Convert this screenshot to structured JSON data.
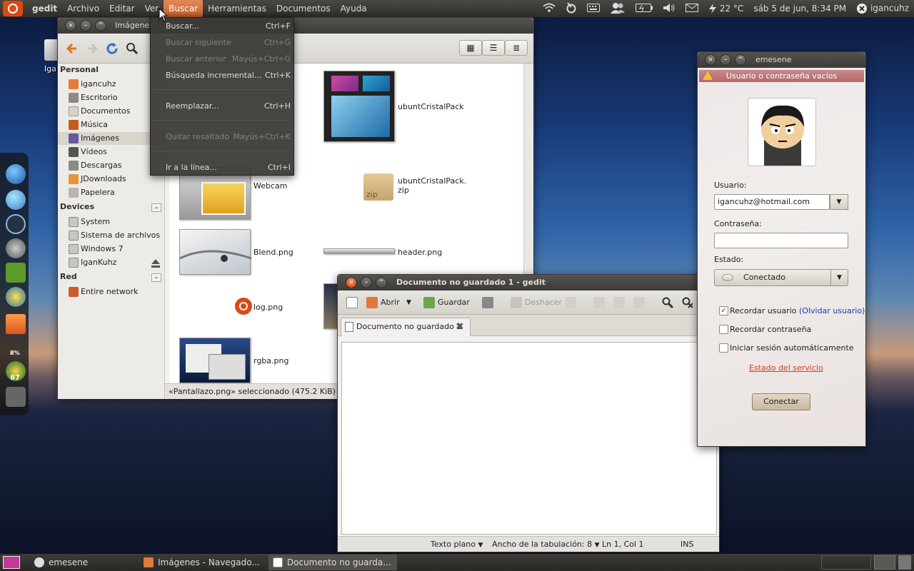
{
  "top_panel": {
    "app_name": "gedit",
    "menus": [
      "Archivo",
      "Editar",
      "Ver",
      "Buscar",
      "Herramientas",
      "Documentos",
      "Ayuda"
    ],
    "active_menu": "Buscar",
    "temperature": "22 °C",
    "clock": "sáb 5 de jun, 8:34 PM",
    "user": "igancuhz"
  },
  "search_menu": {
    "items": [
      {
        "label": "Buscar...",
        "accel": "Ctrl+F",
        "enabled": true
      },
      {
        "label": "Buscar siguiente",
        "accel": "Ctrl+G",
        "enabled": false
      },
      {
        "label": "Buscar anterior",
        "accel": "Mayús+Ctrl+G",
        "enabled": false
      },
      {
        "label": "Búsqueda incremental...",
        "accel": "Ctrl+K",
        "enabled": true
      },
      {
        "label": "Reemplazar...",
        "accel": "Ctrl+H",
        "enabled": true
      },
      {
        "label": "Quitar resaltado",
        "accel": "Mayús+Ctrl+K",
        "enabled": false
      },
      {
        "label": "Ir a la línea...",
        "accel": "Ctrl+I",
        "enabled": true
      }
    ]
  },
  "nautilus": {
    "title": "Imágenes",
    "sidebar": {
      "personal_heading": "Personal",
      "personal": [
        "igancuhz",
        "Escritorio",
        "Documentos",
        "Música",
        "Imágenes",
        "Vídeos",
        "Descargas",
        "JDownloads",
        "Papelera"
      ],
      "selected": "Imágenes",
      "devices_heading": "Devices",
      "devices": [
        "System",
        "Sistema de archivos ...",
        "Windows 7",
        "IganKuhz"
      ],
      "network_heading": "Red",
      "network": [
        "Entire network"
      ]
    },
    "files": [
      {
        "name": "ubuntCristalPack"
      },
      {
        "name": "Webcam"
      },
      {
        "name": "ubuntCristalPack.\nzip"
      },
      {
        "name": "Blend.png"
      },
      {
        "name": "header.png"
      },
      {
        "name": "log.png"
      },
      {
        "name": "rgba.png"
      }
    ],
    "zip_badge": "zip",
    "status": "«Pantallazo.png» seleccionado (475.2 KiB)"
  },
  "gedit": {
    "title": "Documento no guardado 1 - gedit",
    "toolbar": {
      "open": "Abrir",
      "save": "Guardar",
      "undo": "Deshacer"
    },
    "tab_label": "Documento no guardado 1",
    "status": {
      "highlight": "Texto plano",
      "tab_width_label": "Ancho de la tabulación:",
      "tab_width": "8",
      "position": "Ln 1, Col 1",
      "mode": "INS"
    }
  },
  "emesene": {
    "title": "emesene",
    "warning": "Usuario o contraseña vacíos",
    "user_label": "Usuario:",
    "user_value": "igancuhz@hotmail.com",
    "password_label": "Contraseña:",
    "password_value": "",
    "status_label": "Estado:",
    "status_value": "Conectado",
    "remember_user": "Recordar usuario",
    "forget_user": "(Olvidar usuario)",
    "remember_password": "Recordar contraseña",
    "auto_login": "Iniciar sesión automáticamente",
    "service_status": "Estado del servicio",
    "connect": "Conectar"
  },
  "bottom_panel": {
    "tasks": [
      "emesene",
      "Imágenes - Navegado...",
      "Documento no guarda..."
    ],
    "active_task": 2
  },
  "dock": {
    "battery_label": "8%",
    "counter": "67"
  },
  "desktop": {
    "icon_label": "Iga"
  },
  "colors": {
    "accent": "#dd4814",
    "panel": "#3c3b37",
    "warning": "#b26a6c"
  }
}
